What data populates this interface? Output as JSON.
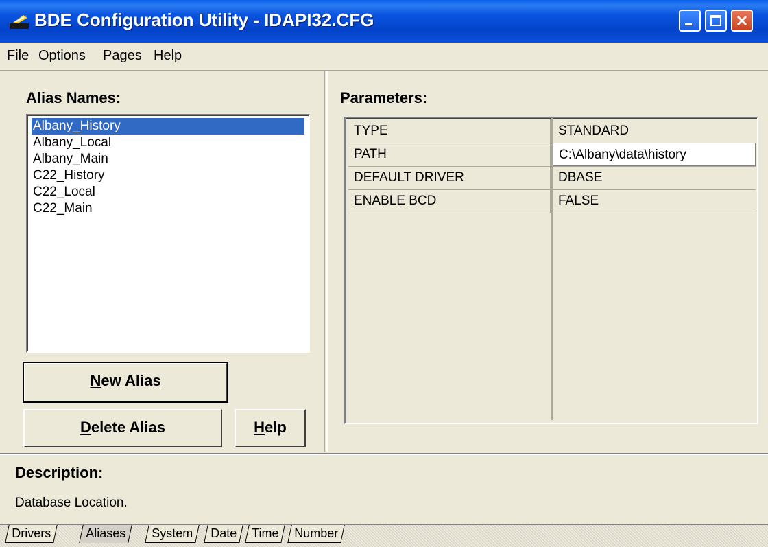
{
  "window": {
    "title": "BDE Configuration Utility - IDAPI32.CFG"
  },
  "menu": [
    "File",
    "Options",
    "Pages",
    "Help"
  ],
  "aliases": {
    "label": "Alias Names:",
    "items": [
      "Albany_History",
      "Albany_Local",
      "Albany_Main",
      "C22_History",
      "C22_Local",
      "C22_Main"
    ],
    "selected": "Albany_History"
  },
  "buttons": {
    "new_alias": {
      "accel": "N",
      "rest": "ew Alias"
    },
    "delete_alias": {
      "accel": "D",
      "rest": "elete Alias"
    },
    "help": {
      "accel": "H",
      "rest": "elp"
    }
  },
  "parameters": {
    "label": "Parameters:",
    "rows": [
      {
        "name": "TYPE",
        "value": "STANDARD"
      },
      {
        "name": "PATH",
        "value": "C:\\Albany\\data\\history"
      },
      {
        "name": "DEFAULT DRIVER",
        "value": "DBASE"
      },
      {
        "name": "ENABLE BCD",
        "value": "FALSE"
      }
    ]
  },
  "description": {
    "label": "Description:",
    "text": "Database Location."
  },
  "tabs": [
    "Drivers",
    "Aliases",
    "System",
    "Date",
    "Time",
    "Number"
  ],
  "active_tab": "Aliases",
  "colors": {
    "titlebar": "#0A54E0",
    "selection": "#316AC5",
    "face": "#ECE9D8"
  }
}
